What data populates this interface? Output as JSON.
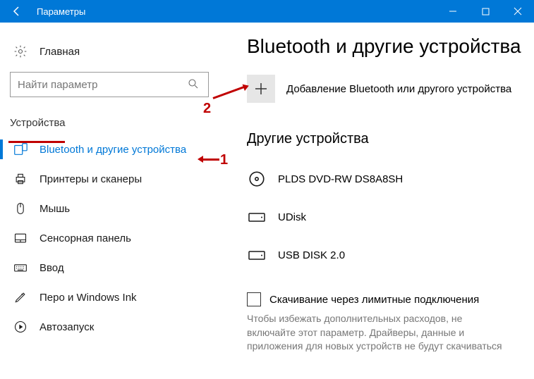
{
  "window": {
    "title": "Параметры"
  },
  "sidebar": {
    "home": "Главная",
    "search_placeholder": "Найти параметр",
    "category": "Устройства",
    "items": [
      {
        "label": "Bluetooth и другие устройства"
      },
      {
        "label": "Принтеры и сканеры"
      },
      {
        "label": "Мышь"
      },
      {
        "label": "Сенсорная панель"
      },
      {
        "label": "Ввод"
      },
      {
        "label": "Перо и Windows Ink"
      },
      {
        "label": "Автозапуск"
      }
    ]
  },
  "content": {
    "title": "Bluetooth и другие устройства",
    "add_label": "Добавление Bluetooth или другого устройства",
    "section": "Другие устройства",
    "devices": [
      {
        "name": "PLDS DVD-RW DS8A8SH"
      },
      {
        "name": "UDisk"
      },
      {
        "name": "USB DISK 2.0"
      }
    ],
    "metered_label": "Скачивание через лимитные подключения",
    "metered_help": "Чтобы избежать дополнительных расходов, не включайте этот параметр. Драйверы, данные и приложения для новых устройств не будут скачиваться"
  },
  "annotations": {
    "one": "1",
    "two": "2"
  }
}
